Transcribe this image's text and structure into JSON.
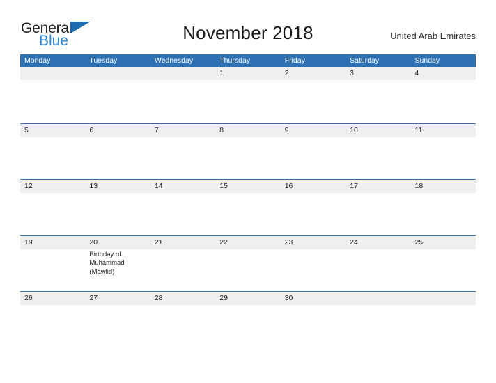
{
  "brand": {
    "name_part1": "General",
    "name_part2": "Blue",
    "flag_icon": "triangle-flag-icon",
    "color_black": "#231f20",
    "color_blue": "#2e86d4"
  },
  "header": {
    "title": "November 2018",
    "region": "United Arab Emirates"
  },
  "theme": {
    "header_blue": "#2e71b2",
    "band_gray": "#efefef",
    "text_dark": "#222222",
    "page_background": "#ffffff"
  },
  "weekdays": [
    "Monday",
    "Tuesday",
    "Wednesday",
    "Thursday",
    "Friday",
    "Saturday",
    "Sunday"
  ],
  "weeks": [
    {
      "days": [
        {
          "num": "",
          "event": ""
        },
        {
          "num": "",
          "event": ""
        },
        {
          "num": "",
          "event": ""
        },
        {
          "num": "1",
          "event": ""
        },
        {
          "num": "2",
          "event": ""
        },
        {
          "num": "3",
          "event": ""
        },
        {
          "num": "4",
          "event": ""
        }
      ]
    },
    {
      "days": [
        {
          "num": "5",
          "event": ""
        },
        {
          "num": "6",
          "event": ""
        },
        {
          "num": "7",
          "event": ""
        },
        {
          "num": "8",
          "event": ""
        },
        {
          "num": "9",
          "event": ""
        },
        {
          "num": "10",
          "event": ""
        },
        {
          "num": "11",
          "event": ""
        }
      ]
    },
    {
      "days": [
        {
          "num": "12",
          "event": ""
        },
        {
          "num": "13",
          "event": ""
        },
        {
          "num": "14",
          "event": ""
        },
        {
          "num": "15",
          "event": ""
        },
        {
          "num": "16",
          "event": ""
        },
        {
          "num": "17",
          "event": ""
        },
        {
          "num": "18",
          "event": ""
        }
      ]
    },
    {
      "days": [
        {
          "num": "19",
          "event": ""
        },
        {
          "num": "20",
          "event": "Birthday of Muhammad (Mawlid)"
        },
        {
          "num": "21",
          "event": ""
        },
        {
          "num": "22",
          "event": ""
        },
        {
          "num": "23",
          "event": ""
        },
        {
          "num": "24",
          "event": ""
        },
        {
          "num": "25",
          "event": ""
        }
      ]
    },
    {
      "days": [
        {
          "num": "26",
          "event": ""
        },
        {
          "num": "27",
          "event": ""
        },
        {
          "num": "28",
          "event": ""
        },
        {
          "num": "29",
          "event": ""
        },
        {
          "num": "30",
          "event": ""
        },
        {
          "num": "",
          "event": ""
        },
        {
          "num": "",
          "event": ""
        }
      ]
    }
  ]
}
